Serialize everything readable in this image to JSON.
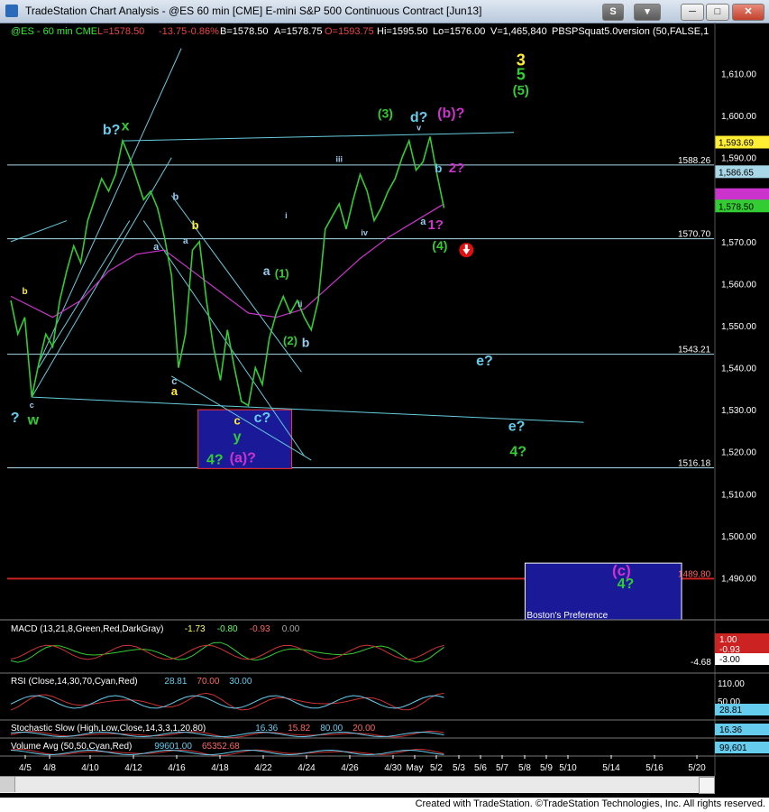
{
  "window": {
    "title": "TradeStation Chart Analysis - @ES 60 min [CME] E-mini S&P 500 Continuous Contract [Jun13]",
    "buttons": [
      "S",
      "▾",
      "─",
      "□",
      "✕"
    ],
    "credit": "Created with TradeStation. ©TradeStation Technologies, Inc. All rights reserved."
  },
  "colors": {
    "background": "#000000",
    "price": "#33cc33",
    "ma": "#cc33cc",
    "trendline": "#66ccdd",
    "hline": "#a8d8e8",
    "cyan_label": "#66ccee",
    "green_label": "#33cc33",
    "yellow_label": "#ffee33",
    "magenta_label": "#cc33cc",
    "box": "#1a1a99",
    "red_line": "#cc2222"
  },
  "header": {
    "symbol": "@ES - 60 min CME",
    "last": "L=1578.50",
    "change": "-13.75",
    "pct": "-0.86%",
    "bid": "B=1578.50",
    "ask": "A=1578.75",
    "open": "O=1593.75",
    "high": "Hi=1595.50",
    "low": "Lo=1576.00",
    "volume": "V=1,465,840",
    "study": "PBSPSquat5.0version (50,FALSE,1"
  },
  "chart_data": [
    {
      "type": "line",
      "title": "@ES - 60 min",
      "x_dates": [
        "4/5",
        "4/8",
        "4/10",
        "4/12",
        "4/16",
        "4/18",
        "4/22",
        "4/24",
        "4/26",
        "4/30",
        "May",
        "5/2",
        "5/3",
        "5/6",
        "5/7",
        "5/8",
        "5/9",
        "5/10",
        "5/14",
        "5/16",
        "5/20"
      ],
      "ylim": [
        1480,
        1620
      ],
      "y_ticks": [
        "1,610.00",
        "1,600.00",
        "1,590.00",
        "1,580.00",
        "1,570.00",
        "1,560.00",
        "1,550.00",
        "1,540.00",
        "1,530.00",
        "1,520.00",
        "1,510.00",
        "1,500.00",
        "1,490.00"
      ],
      "series": [
        {
          "name": "@ES",
          "points": [
            [
              0,
              1556
            ],
            [
              0.5,
              1548
            ],
            [
              1,
              1552
            ],
            [
              1.5,
              1533
            ],
            [
              2,
              1541
            ],
            [
              2.5,
              1548
            ],
            [
              3,
              1545
            ],
            [
              3.5,
              1556
            ],
            [
              4,
              1563
            ],
            [
              4.5,
              1569
            ],
            [
              5,
              1565
            ],
            [
              5.5,
              1575
            ],
            [
              6,
              1580
            ],
            [
              6.5,
              1585
            ],
            [
              7,
              1582
            ],
            [
              7.5,
              1586
            ],
            [
              8,
              1594
            ],
            [
              8.5,
              1590
            ],
            [
              9,
              1585
            ],
            [
              9.5,
              1580
            ],
            [
              10,
              1582
            ],
            [
              10.5,
              1578
            ],
            [
              11,
              1571
            ],
            [
              11.5,
              1562
            ],
            [
              12,
              1540
            ],
            [
              12.5,
              1548
            ],
            [
              13,
              1568
            ],
            [
              13.5,
              1570
            ],
            [
              14,
              1556
            ],
            [
              14.5,
              1545
            ],
            [
              15,
              1537
            ],
            [
              15.5,
              1549
            ],
            [
              16,
              1540
            ],
            [
              16.5,
              1532
            ],
            [
              17,
              1531
            ],
            [
              17.5,
              1540
            ],
            [
              18,
              1536
            ],
            [
              18.5,
              1547
            ],
            [
              19,
              1553
            ],
            [
              19.5,
              1557
            ],
            [
              20,
              1553
            ],
            [
              20.5,
              1556
            ],
            [
              21,
              1552
            ],
            [
              21.5,
              1549
            ],
            [
              22,
              1556
            ],
            [
              22.5,
              1573
            ],
            [
              23,
              1576
            ],
            [
              23.5,
              1579
            ],
            [
              24,
              1573
            ],
            [
              24.5,
              1580
            ],
            [
              25,
              1586
            ],
            [
              25.5,
              1582
            ],
            [
              26,
              1575
            ],
            [
              26.5,
              1578
            ],
            [
              27,
              1582
            ],
            [
              27.5,
              1585
            ],
            [
              28,
              1590
            ],
            [
              28.5,
              1594
            ],
            [
              29,
              1587
            ],
            [
              29.5,
              1589
            ],
            [
              30,
              1595
            ],
            [
              30.5,
              1586
            ],
            [
              31,
              1578
            ]
          ]
        },
        {
          "name": "MA",
          "points": [
            [
              0,
              1557
            ],
            [
              3,
              1552
            ],
            [
              5,
              1556
            ],
            [
              7,
              1563
            ],
            [
              9,
              1567
            ],
            [
              11,
              1568
            ],
            [
              13,
              1563
            ],
            [
              15,
              1558
            ],
            [
              17,
              1553
            ],
            [
              19,
              1552
            ],
            [
              21,
              1554
            ],
            [
              23,
              1560
            ],
            [
              25,
              1566
            ],
            [
              27,
              1571
            ],
            [
              29,
              1575
            ],
            [
              31,
              1579
            ]
          ]
        }
      ],
      "hlines": [
        {
          "value": 1588.26,
          "label": "1588.26"
        },
        {
          "value": 1570.7,
          "label": "1570.70"
        },
        {
          "value": 1543.21,
          "label": "1543.21"
        },
        {
          "value": 1516.18,
          "label": "1516.18"
        }
      ],
      "red_hline": {
        "value": 1489.8,
        "label": "1489.80"
      },
      "price_tags": [
        {
          "value": 1593.69,
          "label": "1,593.69",
          "bg": "#ffee33",
          "fg": "#000000"
        },
        {
          "value": 1586.65,
          "label": "1,586.65",
          "bg": "#a8d8e8",
          "fg": "#000000"
        },
        {
          "value": 1581.2,
          "label": "",
          "bg": "#cc33cc",
          "fg": "#000000"
        },
        {
          "value": 1578.5,
          "label": "1,578.50",
          "bg": "#33cc33",
          "fg": "#000000"
        }
      ],
      "boxes": [
        {
          "x0": 13.4,
          "x1": 20.1,
          "y0": 1530,
          "y1": 1516,
          "label": ""
        },
        {
          "x0": 36.8,
          "x1": 48,
          "y0": 1493.5,
          "y1": 1480,
          "label": "Boston's Preference"
        }
      ],
      "trendlines": [
        [
          [
            1.5,
            1533
          ],
          [
            11.5,
            1590
          ]
        ],
        [
          [
            2.0,
            1541
          ],
          [
            12.2,
            1616
          ]
        ],
        [
          [
            0.0,
            1570
          ],
          [
            4.0,
            1575
          ]
        ],
        [
          [
            2.0,
            1540
          ],
          [
            8.5,
            1575
          ]
        ],
        [
          [
            8.0,
            1594
          ],
          [
            36,
            1596
          ]
        ],
        [
          [
            1.5,
            1533
          ],
          [
            41,
            1527
          ]
        ],
        [
          [
            11.5,
            1581
          ],
          [
            20.8,
            1539
          ]
        ],
        [
          [
            9.5,
            1575
          ],
          [
            21.0,
            1519
          ]
        ],
        [
          [
            11.5,
            1538
          ],
          [
            21.5,
            1518
          ]
        ]
      ],
      "annotations": [
        {
          "text": "b?",
          "x": 7.2,
          "y": 1595.5,
          "color": "cyan",
          "size": 16
        },
        {
          "text": "x",
          "x": 8.2,
          "y": 1596.5,
          "color": "green",
          "size": 16
        },
        {
          "text": "b",
          "x": 11.8,
          "y": 1580,
          "color": "lightblue",
          "size": 11
        },
        {
          "text": "a",
          "x": 10.4,
          "y": 1568,
          "color": "lightblue",
          "size": 11
        },
        {
          "text": "b",
          "x": 13.2,
          "y": 1573,
          "color": "yellow",
          "size": 13
        },
        {
          "text": "a",
          "x": 12.5,
          "y": 1569.5,
          "color": "lightblue",
          "size": 10
        },
        {
          "text": "c",
          "x": 11.7,
          "y": 1536,
          "color": "lightblue",
          "size": 11
        },
        {
          "text": "a",
          "x": 11.7,
          "y": 1533.5,
          "color": "yellow",
          "size": 13
        },
        {
          "text": "a",
          "x": 18.3,
          "y": 1562,
          "color": "lightblue",
          "size": 14
        },
        {
          "text": "(1)",
          "x": 19.4,
          "y": 1561.5,
          "color": "green",
          "size": 13
        },
        {
          "text": "ii",
          "x": 20.7,
          "y": 1554.5,
          "color": "lightblue",
          "size": 9
        },
        {
          "text": "(2)",
          "x": 20.0,
          "y": 1545.5,
          "color": "green",
          "size": 13
        },
        {
          "text": "b",
          "x": 21.1,
          "y": 1545,
          "color": "lightblue",
          "size": 14
        },
        {
          "text": "i",
          "x": 19.7,
          "y": 1575.5,
          "color": "lightblue",
          "size": 9
        },
        {
          "text": "iii",
          "x": 23.5,
          "y": 1589,
          "color": "lightblue",
          "size": 9
        },
        {
          "text": "iv",
          "x": 25.3,
          "y": 1571.5,
          "color": "lightblue",
          "size": 9
        },
        {
          "text": "(3)",
          "x": 26.8,
          "y": 1599.5,
          "color": "green",
          "size": 14
        },
        {
          "text": "d?",
          "x": 29.2,
          "y": 1598.5,
          "color": "cyan",
          "size": 16
        },
        {
          "text": "(b)?",
          "x": 31.5,
          "y": 1599.5,
          "color": "magenta",
          "size": 16
        },
        {
          "text": "v",
          "x": 29.2,
          "y": 1596.5,
          "color": "lightblue",
          "size": 9
        },
        {
          "text": "b",
          "x": 30.6,
          "y": 1586.5,
          "color": "cyan",
          "size": 13
        },
        {
          "text": "2?",
          "x": 31.9,
          "y": 1586.5,
          "color": "magenta",
          "size": 15
        },
        {
          "text": "a",
          "x": 29.5,
          "y": 1574,
          "color": "lightblue",
          "size": 11
        },
        {
          "text": "1?",
          "x": 30.4,
          "y": 1573,
          "color": "magenta",
          "size": 15
        },
        {
          "text": "(4)",
          "x": 30.7,
          "y": 1568,
          "color": "green",
          "size": 14
        },
        {
          "text": "c",
          "x": 1.5,
          "y": 1530.5,
          "color": "lightblue",
          "size": 9
        },
        {
          "text": "?",
          "x": 0.3,
          "y": 1527,
          "color": "cyan",
          "size": 16
        },
        {
          "text": "w",
          "x": 1.6,
          "y": 1526.5,
          "color": "green",
          "size": 16
        },
        {
          "text": "c",
          "x": 16.2,
          "y": 1526.5,
          "color": "yellow",
          "size": 13
        },
        {
          "text": "y",
          "x": 16.2,
          "y": 1522.5,
          "color": "green",
          "size": 16
        },
        {
          "text": "c?",
          "x": 18.0,
          "y": 1527,
          "color": "cyan",
          "size": 16
        },
        {
          "text": "4?",
          "x": 14.6,
          "y": 1517,
          "color": "green",
          "size": 16
        },
        {
          "text": "(a)?",
          "x": 16.6,
          "y": 1517.5,
          "color": "magenta",
          "size": 16
        },
        {
          "text": "e?",
          "x": 33.9,
          "y": 1540.5,
          "color": "cyan",
          "size": 16
        },
        {
          "text": "e?",
          "x": 36.2,
          "y": 1525,
          "color": "cyan",
          "size": 16
        },
        {
          "text": "4?",
          "x": 36.3,
          "y": 1519,
          "color": "green",
          "size": 16
        },
        {
          "text": "3",
          "x": 36.5,
          "y": 1612,
          "color": "yellow",
          "size": 18
        },
        {
          "text": "5",
          "x": 36.5,
          "y": 1608.5,
          "color": "green",
          "size": 18
        },
        {
          "text": "(5)",
          "x": 36.5,
          "y": 1605,
          "color": "green",
          "size": 15
        },
        {
          "text": "(c)",
          "x": 43.7,
          "y": 1490.5,
          "color": "magenta",
          "size": 17
        },
        {
          "text": "4?",
          "x": 44.0,
          "y": 1487.5,
          "color": "green",
          "size": 16
        },
        {
          "text": "b",
          "x": 1.0,
          "y": 1557.5,
          "color": "yellow",
          "size": 10
        }
      ]
    },
    {
      "type": "line",
      "title": "MACD",
      "legend": [
        "MACD (13,21,8,Green,Red,DarkGray)",
        "-1.73",
        "-0.80",
        "-0.93",
        "0.00"
      ],
      "y_ticks": [
        "-4.68"
      ],
      "price_tags": [
        "1.00",
        "-0.93",
        "-3.00"
      ]
    },
    {
      "type": "line",
      "title": "RSI",
      "legend": [
        "RSI (Close,14,30,70,Cyan,Red)",
        "28.81",
        "70.00",
        "30.00"
      ],
      "y_ticks": [
        "110.00",
        "50.00"
      ],
      "price_tags": [
        "28.81"
      ]
    },
    {
      "type": "line",
      "title": "Stochastic Slow",
      "legend": [
        "Stochastic Slow (High,Low,Close,14,3,3,1,20,80)",
        "16.36",
        "15.82",
        "80.00",
        "20.00"
      ],
      "price_tags": [
        "16.36"
      ]
    },
    {
      "type": "bar",
      "title": "Volume Avg",
      "legend": [
        "Volume Avg (50,50,Cyan,Red)",
        "99601.00",
        "65352.68"
      ],
      "price_tags": [
        "99,601"
      ]
    }
  ]
}
